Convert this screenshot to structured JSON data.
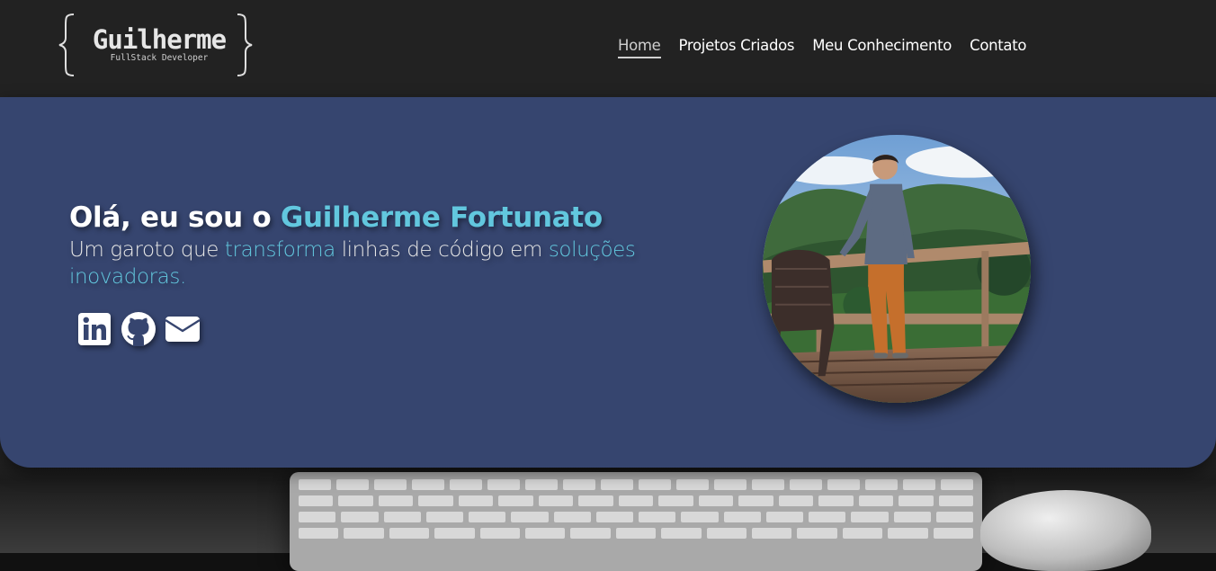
{
  "logo": {
    "name": "Guilherme",
    "subtitle": "FullStack Developer"
  },
  "nav": {
    "items": [
      {
        "label": "Home",
        "active": true
      },
      {
        "label": "Projetos Criados",
        "active": false
      },
      {
        "label": "Meu Conhecimento",
        "active": false
      },
      {
        "label": "Contato",
        "active": false
      }
    ]
  },
  "hero": {
    "greeting_prefix": "Olá, eu sou o ",
    "greeting_name": "Guilherme Fortunato",
    "tagline_part1": "Um garoto que ",
    "tagline_highlight1": "transforma",
    "tagline_part2": " linhas de código em ",
    "tagline_highlight2": "soluções inovadoras.",
    "socials": [
      {
        "icon": "linkedin-icon"
      },
      {
        "icon": "github-icon"
      },
      {
        "icon": "envelope-icon"
      }
    ],
    "profile_photo": "profile-photo"
  },
  "colors": {
    "header_bg": "#222222",
    "hero_bg": "#36456f",
    "accent": "#62c7de",
    "text": "#ffffff"
  }
}
